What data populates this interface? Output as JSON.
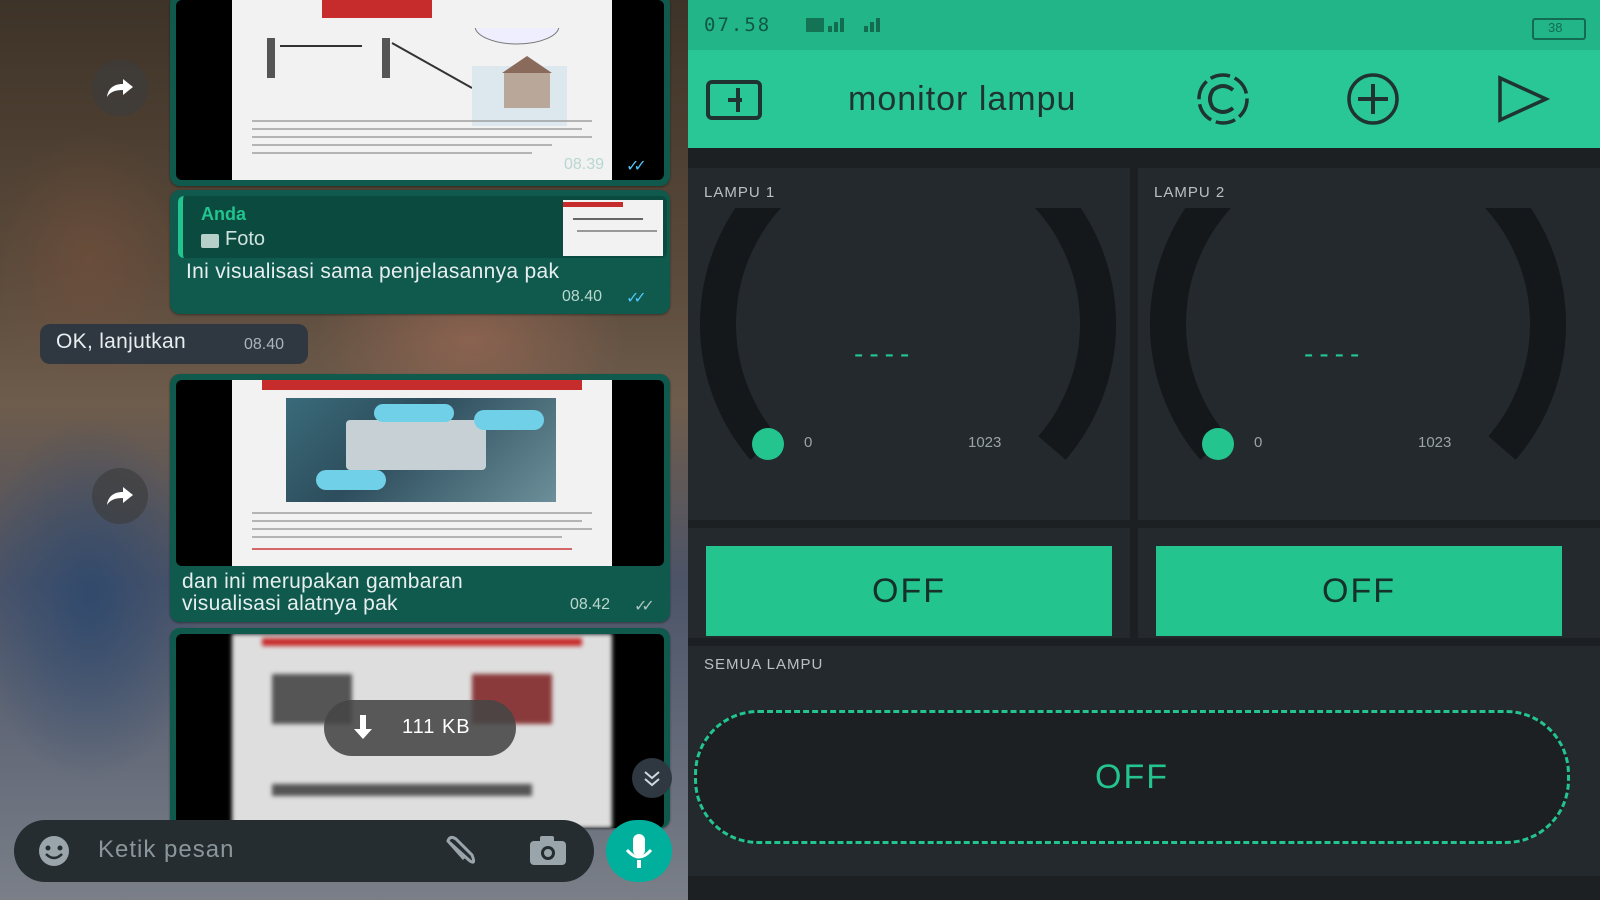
{
  "chat": {
    "messages": [
      {
        "type": "image-doc",
        "time": "08.39"
      },
      {
        "type": "reply",
        "reply_author": "Anda",
        "reply_kind": "Foto",
        "text": "Ini visualisasi sama penjelasannya pak",
        "time": "08.40"
      },
      {
        "type": "incoming",
        "text": "OK, lanjutkan",
        "time": "08.40"
      },
      {
        "type": "image-caption",
        "line1": "dan ini merupakan gambaran",
        "line2": "visualisasi alatnya pak",
        "time": "08.42"
      },
      {
        "type": "download",
        "size": "111 KB"
      }
    ],
    "input_placeholder": "Ketik pesan",
    "icons": {
      "emoji": "emoji-icon",
      "attach": "paperclip-icon",
      "camera": "camera-icon",
      "mic": "microphone-icon",
      "forward": "forward-icon",
      "scroll": "scroll-down-icon"
    }
  },
  "blynk": {
    "status": {
      "time": "07.58",
      "battery": "38"
    },
    "title": "monitor lampu",
    "icons": {
      "device": "device-icon",
      "connection": "connection-icon",
      "add": "add-widget-icon",
      "play": "play-icon"
    },
    "gauges": [
      {
        "label": "LAMPU 1",
        "value": "----",
        "min": "0",
        "max": "1023"
      },
      {
        "label": "LAMPU 2",
        "value": "----",
        "min": "0",
        "max": "1023"
      }
    ],
    "buttons": [
      {
        "label": "OFF"
      },
      {
        "label": "OFF"
      }
    ],
    "all_lamps": {
      "label": "SEMUA LAMPU",
      "button": "OFF"
    },
    "colors": {
      "accent": "#23c48e",
      "panel": "#24292d",
      "bg": "#1c2023"
    }
  }
}
